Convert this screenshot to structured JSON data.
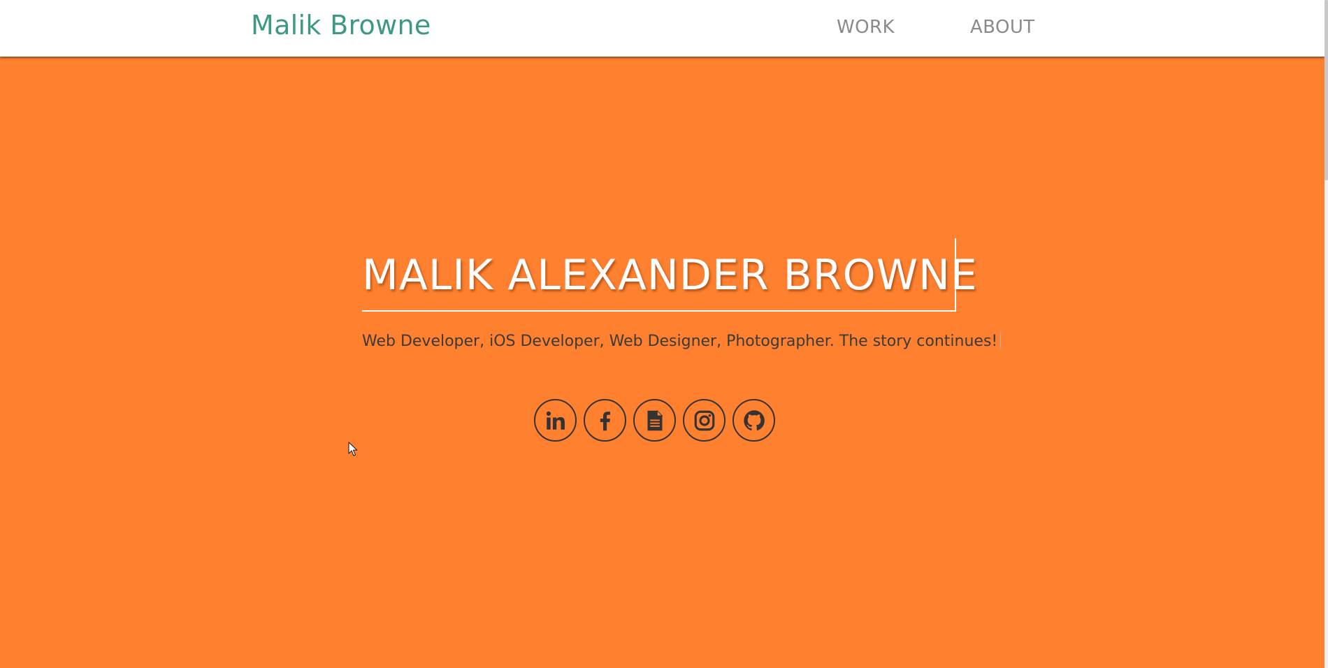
{
  "navbar": {
    "brand": "Malik Browne",
    "links": [
      {
        "label": "WORK"
      },
      {
        "label": "ABOUT"
      }
    ]
  },
  "hero": {
    "title": "MALIK ALEXANDER BROWNE",
    "subtitle": "Web Developer, iOS Developer, Web Designer, Photographer. The story continues!",
    "social_icons": [
      {
        "icon": "linkedin-icon"
      },
      {
        "icon": "facebook-icon"
      },
      {
        "icon": "resume-document-icon"
      },
      {
        "icon": "instagram-icon"
      },
      {
        "icon": "github-icon"
      }
    ]
  },
  "colors": {
    "hero_background": "#ff8130",
    "brand": "#3d9984",
    "nav_link": "#8a8a8a",
    "title": "#ffffff",
    "subtitle": "#3a3a3a",
    "icon": "#333333"
  }
}
